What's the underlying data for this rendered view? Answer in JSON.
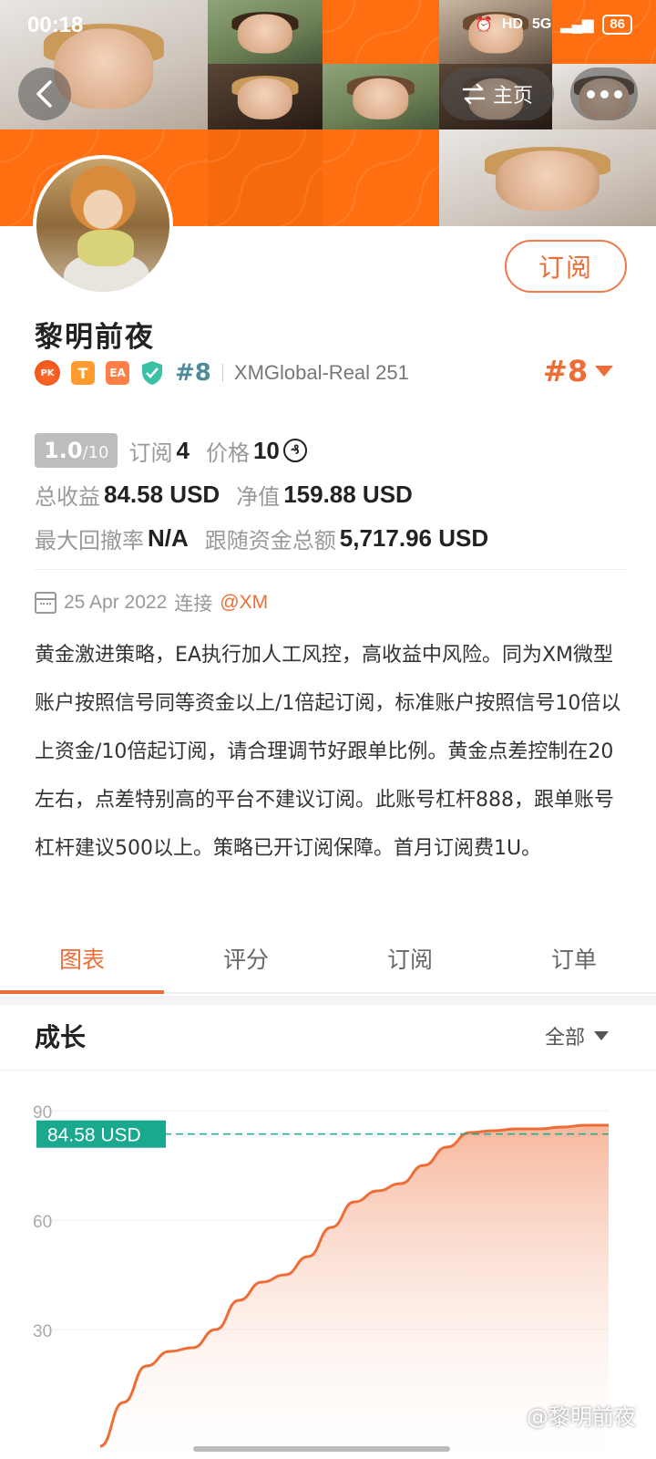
{
  "status_bar": {
    "time": "00:18",
    "network": "5G",
    "hd": "HD",
    "battery": "86"
  },
  "nav": {
    "home_label": "主页"
  },
  "profile": {
    "name": "黎明前夜",
    "subscribe_label": "订阅",
    "badges": {
      "pk": "PK",
      "t": "T",
      "ea": "EA"
    },
    "rank_small": "#8",
    "server": "XMGlobal-Real 251",
    "rank_big": "#8"
  },
  "stats": {
    "score": "1.0",
    "score_max": "/10",
    "subscribe_label": "订阅",
    "subscribe_count": "4",
    "price_label": "价格",
    "price_value": "10",
    "coin_symbol": "₰",
    "total_profit_label": "总收益",
    "total_profit_value": "84.58 USD",
    "equity_label": "净值",
    "equity_value": "159.88 USD",
    "max_dd_label": "最大回撤率",
    "max_dd_value": "N/A",
    "follow_total_label": "跟随资金总额",
    "follow_total_value": "5,717.96 USD"
  },
  "since": {
    "date": "25 Apr 2022",
    "connect_label": "连接",
    "broker": "@XM"
  },
  "description": "黄金激进策略，EA执行加人工风控，高收益中风险。同为XM微型账户按照信号同等资金以上/1倍起订阅，标准账户按照信号10倍以上资金/10倍起订阅，请合理调节好跟单比例。黄金点差控制在20左右，点差特别高的平台不建议订阅。此账号杠杆888，跟单账号杠杆建议500以上。策略已开订阅保障。首月订阅费1U。",
  "tabs": [
    {
      "label": "图表",
      "active": true
    },
    {
      "label": "评分",
      "active": false
    },
    {
      "label": "订阅",
      "active": false
    },
    {
      "label": "订单",
      "active": false
    }
  ],
  "growth": {
    "title": "成长",
    "range_label": "全部"
  },
  "chart_data": {
    "type": "area",
    "y_ticks": [
      "90",
      "60",
      "30"
    ],
    "ylim": [
      0,
      90
    ],
    "current_label": "84.58 USD",
    "current_value": 84.58,
    "values": [
      -2,
      10,
      20,
      24,
      25,
      30,
      38,
      43,
      45,
      50,
      58,
      65,
      68,
      70,
      75,
      80,
      84,
      84.5,
      85,
      85,
      85.5,
      86,
      86
    ],
    "colors": {
      "line": "#ee6d36",
      "fill_top": "#f6b397",
      "marker": "#1aa88f"
    }
  },
  "watermark": "@黎明前夜"
}
